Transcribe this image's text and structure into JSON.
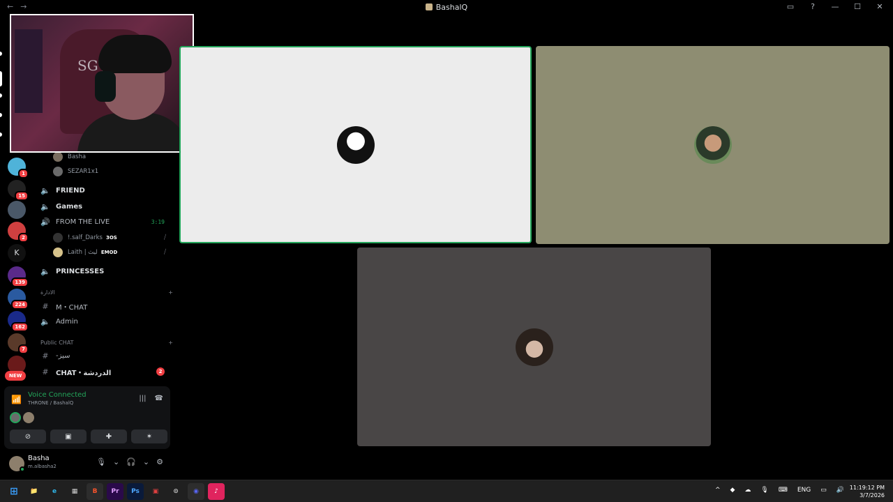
{
  "window": {
    "title": "BashalQ",
    "nav_back": "←",
    "nav_forward": "→",
    "controls": [
      "▭",
      "?",
      "—",
      "☐",
      "✕"
    ]
  },
  "rail": {
    "badges": [
      "1",
      "15",
      "2",
      "139",
      "224",
      "162",
      "7"
    ],
    "letter": "K",
    "new_label": "NEW"
  },
  "channels": {
    "voice_users_top": [
      "Basha",
      "SEZAR1x1"
    ],
    "friend": "FRIEND",
    "games": "Games",
    "live": "FROM THE LIVE",
    "live_timer": "3:19",
    "live_users": [
      {
        "name": "!.salf_Darks",
        "tag": "3OS"
      },
      {
        "name": "Laith | ليث",
        "tag": "EMOD"
      }
    ],
    "princesses": "PRINCESSES",
    "cat_admin": "الادارة",
    "m_chat": "M・CHAT",
    "admin": "Admin",
    "cat_public": "Public CHAT",
    "text_1": "-سيز",
    "chat_2": "CHAT・الدردشة",
    "chat_2_unread": "2"
  },
  "voice": {
    "status": "Voice Connected",
    "location": "THRONE / BashalQ"
  },
  "user": {
    "name": "Basha",
    "handle": "m.albasha2"
  },
  "cam": {
    "chair_text": "SG"
  },
  "taskbar": {
    "apps": [
      "⊞",
      "📁",
      "e",
      "▦",
      "B",
      "Pr",
      "Ps",
      "▣",
      "⊙",
      "◉",
      "♪"
    ],
    "tray": [
      "^",
      "ENG"
    ],
    "time": "11:19:12 PM",
    "date": "3/7/2026"
  }
}
